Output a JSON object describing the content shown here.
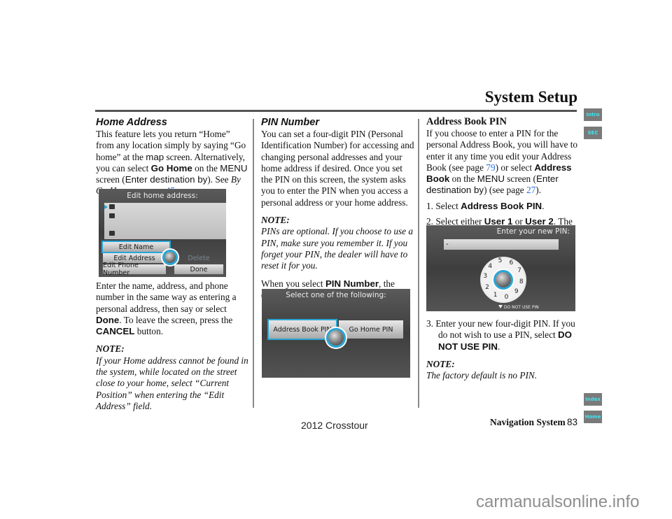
{
  "header": {
    "title": "System Setup"
  },
  "side_tabs": {
    "intro": "Intro",
    "sec": "SEC",
    "index": "Index",
    "home": "Home"
  },
  "colors": {
    "tab_bg": "#7a7a7a",
    "tab_text": "#3ee6f0",
    "link": "#2e6fd8",
    "screen_accent": "#2aa6d6"
  },
  "left": {
    "heading": "Home Address",
    "p1": {
      "a": "This feature lets you return “Home” from any location simply by saying “Go home” at the ",
      "map": "map",
      "b": " screen. Alternatively, you can select ",
      "go_home": "Go Home",
      "c": " on the ",
      "menu": "MENU",
      "d": " screen (",
      "enter_dest": "Enter destination by",
      "e": "). See ",
      "by_go_home": "By Go Home",
      "f": " on page ",
      "page_link": "45",
      "g": "."
    },
    "screen": {
      "title": "Edit home address:",
      "buttons": {
        "edit_name": "Edit Name",
        "edit_address": "Edit Address",
        "edit_phone": "Edit Phone Number",
        "delete": "Delete",
        "done": "Done"
      }
    },
    "p2": {
      "a": "Enter the name, address, and phone number in the same way as entering a personal address, then say or select ",
      "done": "Done",
      "b": ". To leave the screen, press the ",
      "cancel": "CANCEL",
      "c": " button."
    },
    "note_label": "NOTE:",
    "note_text": "If your Home address cannot be found in the system, while located on the street close to your home, select “Current Position” when entering the “Edit Address” field."
  },
  "middle": {
    "heading": "PIN Number",
    "p1": "You can set a four-digit PIN (Personal Identification Number) for accessing and changing personal addresses and your home address if desired. Once you set the PIN on this screen, the system asks you to enter the PIN when you access a personal address or your home address.",
    "note_label": "NOTE:",
    "note_text": "PINs are optional. If you choose to use a PIN, make sure you remember it. If you forget your PIN, the dealer will have to reset it for you.",
    "p2": {
      "a": "When you select ",
      "pin_number": "PIN Number",
      "b": ", the display changes to:"
    },
    "screen": {
      "title": "Select one of the following:",
      "buttons": {
        "address_book_pin": "Address Book PIN",
        "go_home_pin": "Go Home PIN"
      }
    }
  },
  "right": {
    "heading": "Address Book PIN",
    "p1": {
      "a": "If you choose to enter a PIN for the personal Address Book, you will have to enter it any time you edit your Address Book (see page ",
      "page1": "79",
      "b": ") or select ",
      "address_book": "Address Book",
      "c": " on the ",
      "menu": "MENU",
      "d": " screen (",
      "enter_dest": "Enter destination by",
      "e": ") (see page ",
      "page2": "27",
      "f": ")."
    },
    "steps": [
      {
        "num": "1.",
        "a": "Select ",
        "b1": "Address Book PIN",
        "c": "."
      },
      {
        "num": "2.",
        "a": "Select either ",
        "b1": "User 1",
        "mid": " or ",
        "b2": "User 2",
        "c": ". The display changes to:"
      },
      {
        "num": "3.",
        "a": "Enter your new four-digit PIN. If you do not wish to use a PIN, select ",
        "b1": "DO NOT USE PIN",
        "c": "."
      }
    ],
    "screen": {
      "title": "Enter your new PIN:",
      "field_value": "-",
      "dial_digits": [
        "5",
        "6",
        "7",
        "8",
        "9",
        "0",
        "1",
        "2",
        "3",
        "4"
      ],
      "do_not_use": "DO NOT USE PIN"
    },
    "note_label": "NOTE:",
    "note_text": "The factory default is no PIN."
  },
  "footer": {
    "section": "Navigation System",
    "page": "83",
    "model": "2012 Crosstour",
    "watermark": "carmanualsonline.info"
  }
}
